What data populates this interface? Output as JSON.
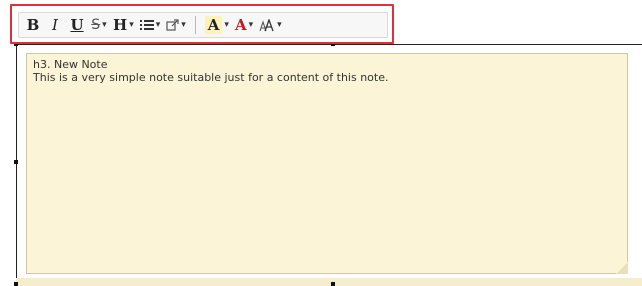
{
  "toolbar": {
    "bold": "B",
    "italic": "I",
    "underline": "U",
    "strikethrough_glyph": "S",
    "heading": "H",
    "font_color_glyph": "A",
    "highlight_glyph": "A",
    "dropdown_caret": "▾",
    "highlight_color": "#e0303a",
    "text_color": "#c0181e"
  },
  "note": {
    "title": "h3. New Note",
    "body": "This is a very simple note suitable just for a content of this note.",
    "background_color": "#fbf4d6"
  }
}
